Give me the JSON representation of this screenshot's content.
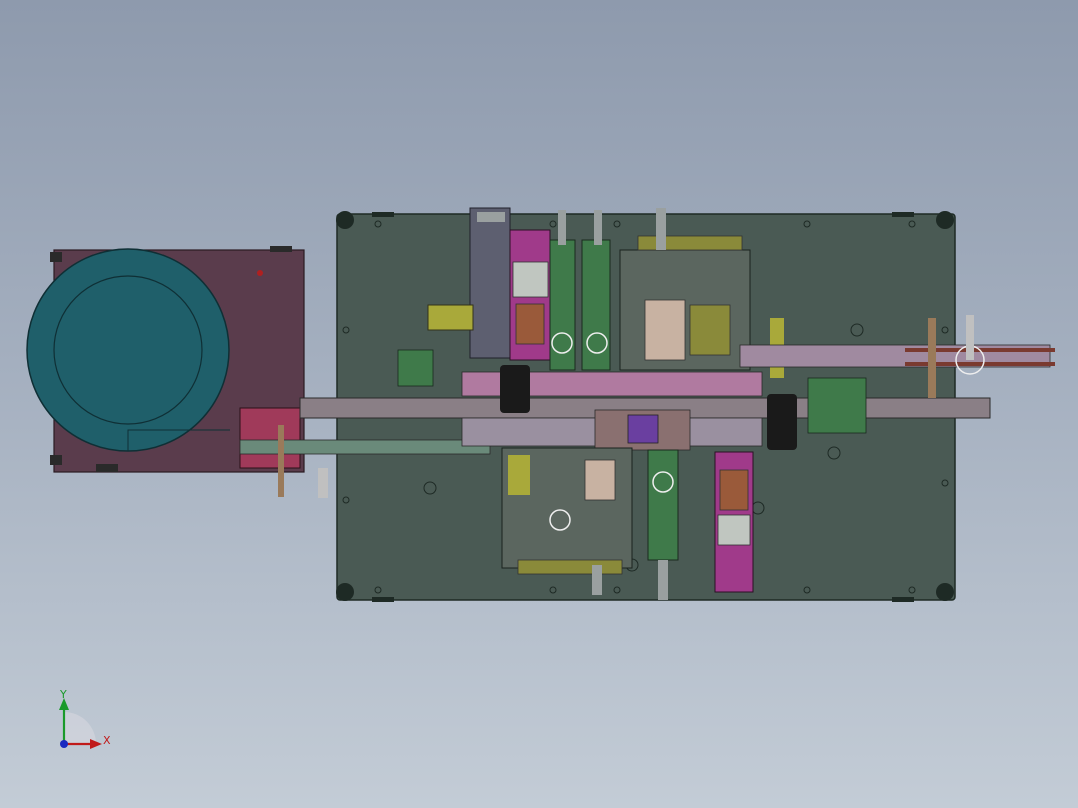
{
  "view": {
    "background_top": "#8e9aad",
    "background_bottom": "#c3ccd6"
  },
  "colors": {
    "base_plate": "#4a5a54",
    "feeder_bowl": "#1f5f6a",
    "feeder_frame": "#5a3c4c",
    "conveyor": "#8a7f86",
    "frame_green": "#5c7a4a",
    "accent_magenta": "#a03a8a",
    "accent_purple": "#6a3fa0",
    "accent_olive": "#8a8a3a",
    "accent_rust": "#9a5a3a"
  },
  "icons": {
    "triad": "coordinate-triad-icon"
  },
  "triad": {
    "y_label": "Y",
    "x_label": "X"
  }
}
